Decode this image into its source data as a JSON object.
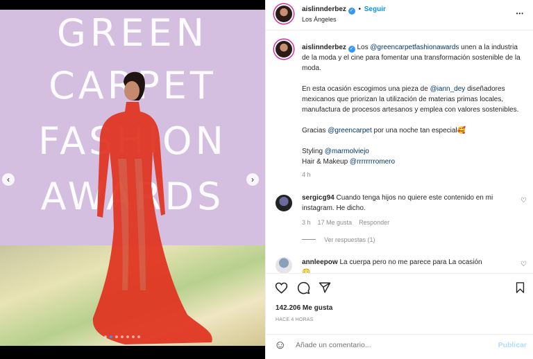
{
  "photo": {
    "bg_lines": [
      "GREEN",
      "CARPET",
      "FASHION",
      "AWARDS"
    ],
    "prev_arrow": "‹",
    "next_arrow": "›",
    "slide_count": 7,
    "active_slide": 1
  },
  "header": {
    "username": "aislinnderbez",
    "verified": "✓",
    "bullet": "•",
    "follow": "Seguir",
    "location": "Los Ángeles",
    "more": "•••"
  },
  "caption": {
    "username": "aislinnderbez",
    "p1_a": "Los ",
    "p1_link": "@greencarpetfashionawards",
    "p1_b": " unen a la industria de la moda y el cine para fomentar una transformación sostenible de la moda.",
    "p2_a": "En esta ocasión escogimos una pieza de ",
    "p2_link": "@iann_dey",
    "p2_b": " diseñadores mexicanos que priorizan la utilización de materias primas locales, manufactura de procesos artesanos y emplea con valores sostenibles.",
    "p3_a": "Gracias ",
    "p3_link": "@greencarpet",
    "p3_b": " por una noche tan especial🥰",
    "p4_a": "Styling ",
    "p4_link": "@marmolviejo",
    "p5_a": "Hair & Makeup ",
    "p5_link": "@rrrrrrrromero",
    "time": "4 h"
  },
  "comments": [
    {
      "username": "sergicg94",
      "text": "Cuando tenga hijos no quiere este contenido en mi instagram. He dicho.",
      "time": "3 h",
      "likes": "17 Me gusta",
      "reply": "Responder",
      "replies": "Ver respuestas (1)"
    },
    {
      "username": "annleepow",
      "text": "La cuerpa pero no me parece para La ocasión",
      "emoji": "😳"
    }
  ],
  "actions": {
    "likes": "142.206 Me gusta",
    "timestamp": "HACE 4 HORAS"
  },
  "add_comment": {
    "emoji": "☺",
    "placeholder": "Añade un comentario...",
    "publish": "Publicar"
  },
  "colors": {
    "accent": "#0095f6",
    "dress": "#e0331f",
    "backdrop": "#d4bfe0"
  }
}
